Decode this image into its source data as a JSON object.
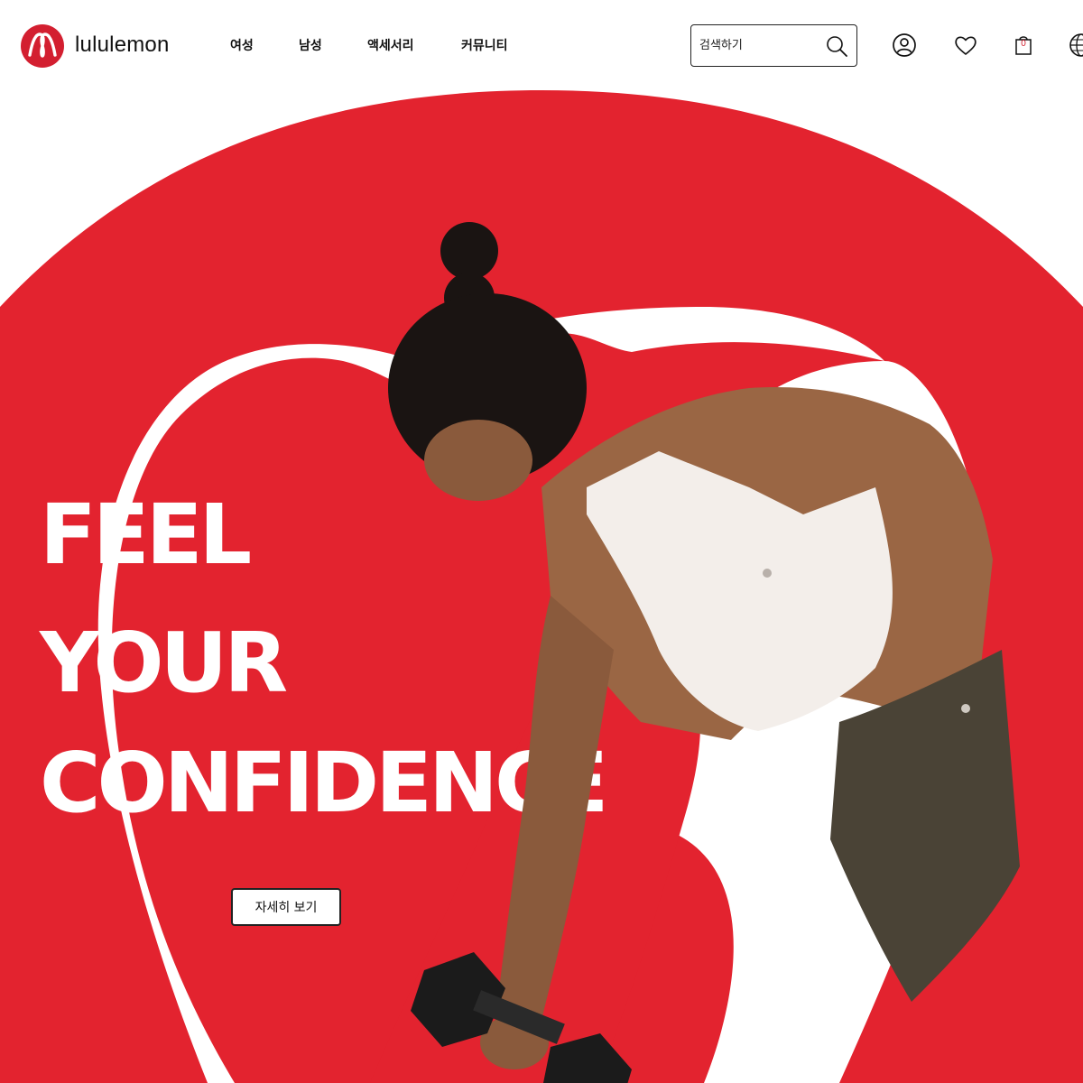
{
  "brand": {
    "name": "lululemon",
    "color": "#d31f30"
  },
  "nav": {
    "items": [
      {
        "label": "여성"
      },
      {
        "label": "남성"
      },
      {
        "label": "액세서리"
      },
      {
        "label": "커뮤니티"
      }
    ]
  },
  "search": {
    "placeholder": "검색하기"
  },
  "header_icons": [
    "account-icon",
    "heart-icon",
    "shopping-bag-icon",
    "globe-icon"
  ],
  "cart": {
    "count": "0"
  },
  "hero": {
    "headline": {
      "line1": "FEEL",
      "line2": "YOUR",
      "line3": "CONFIDENCE"
    },
    "cta_label": "자세히 보기",
    "accent_color": "#e3232f"
  }
}
